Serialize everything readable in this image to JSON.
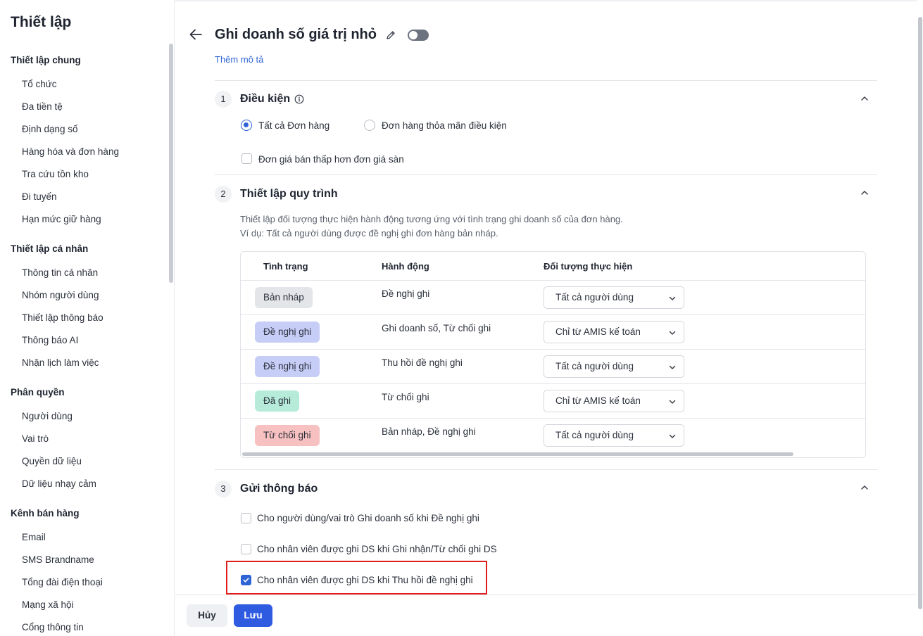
{
  "sidebar": {
    "title": "Thiết lập",
    "groups": [
      {
        "label": "Thiết lập chung",
        "items": [
          "Tổ chức",
          "Đa tiền tệ",
          "Định dạng số",
          "Hàng hóa và đơn hàng",
          "Tra cứu tồn kho",
          "Đi tuyến",
          "Hạn mức giữ hàng"
        ]
      },
      {
        "label": "Thiết lập cá nhân",
        "items": [
          "Thông tin cá nhân",
          "Nhóm người dùng",
          "Thiết lập thông báo",
          "Thông báo AI",
          "Nhận lịch làm việc"
        ]
      },
      {
        "label": "Phân quyền",
        "items": [
          "Người dùng",
          "Vai trò",
          "Quyền dữ liệu",
          "Dữ liệu nhạy cảm"
        ]
      },
      {
        "label": "Kênh bán hàng",
        "items": [
          "Email",
          "SMS Brandname",
          "Tổng đài điện thoại",
          "Mạng xã hội",
          "Cổng thông tin"
        ]
      }
    ]
  },
  "header": {
    "title": "Ghi doanh số giá trị nhỏ",
    "add_description": "Thêm mô tả",
    "toggle_on": false
  },
  "section1": {
    "number": "1",
    "title": "Điều kiện",
    "radio_all": "Tất cả Đơn hàng",
    "radio_condition": "Đơn hàng thỏa mãn điều kiện",
    "selected": "all",
    "checkbox_label": "Đơn giá bán thấp hơn đơn giá sàn"
  },
  "section2": {
    "number": "2",
    "title": "Thiết lập quy trình",
    "desc1": "Thiết lập đối tượng thực hiện hành động tương ứng với tình trạng ghi doanh số của đơn hàng.",
    "desc2": "Ví dụ: Tất cả người dùng được đề nghị ghi đơn hàng bản nháp.",
    "columns": [
      "Tình trạng",
      "Hành động",
      "Đối tượng thực hiện"
    ],
    "rows": [
      {
        "status": "Bản nháp",
        "status_color": "#e4e5e8",
        "action": "Đề nghị ghi",
        "actor": "Tất cả người dùng"
      },
      {
        "status": "Đề nghị ghi",
        "status_color": "#c6cdf7",
        "action": "Ghi doanh số, Từ chối ghi",
        "actor": "Chỉ từ AMIS kế toán"
      },
      {
        "status": "Đề nghị ghi",
        "status_color": "#c6cdf7",
        "action": "Thu hồi đề nghị ghi",
        "actor": "Tất cả người dùng"
      },
      {
        "status": "Đã ghi",
        "status_color": "#b6ebd9",
        "action": "Từ chối ghi",
        "actor": "Chỉ từ AMIS kế toán"
      },
      {
        "status": "Từ chối ghi",
        "status_color": "#f7c1c1",
        "action": "Bản nháp, Đề nghị ghi",
        "actor": "Tất cả người dùng"
      }
    ]
  },
  "section3": {
    "number": "3",
    "title": "Gửi thông báo",
    "options": [
      {
        "label": "Cho người dùng/vai trò Ghi doanh số khi Đề nghị ghi",
        "checked": false
      },
      {
        "label": "Cho nhân viên được ghi DS khi Ghi nhận/Từ chối ghi DS",
        "checked": false
      },
      {
        "label": "Cho nhân viên được ghi DS khi Thu hồi đề nghị ghi",
        "checked": true
      }
    ]
  },
  "footer": {
    "cancel": "Hủy",
    "save": "Lưu"
  },
  "colors": {
    "accent": "#2f5be0",
    "link": "#2f64d6",
    "highlight": "#e01e1e"
  }
}
